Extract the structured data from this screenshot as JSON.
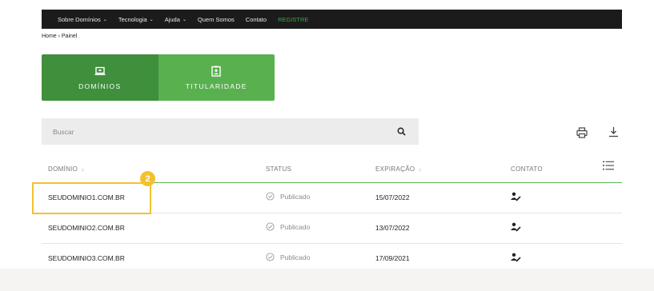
{
  "nav": {
    "items": [
      {
        "label": "Sobre Domínios",
        "dropdown": true
      },
      {
        "label": "Tecnologia",
        "dropdown": true
      },
      {
        "label": "Ajuda",
        "dropdown": true
      },
      {
        "label": "Quem Somos",
        "dropdown": false
      },
      {
        "label": "Contato",
        "dropdown": false
      },
      {
        "label": "REGISTRE",
        "dropdown": false
      }
    ],
    "dropdown_glyph": "⌄"
  },
  "breadcrumb": "Home › Painel",
  "tabs": [
    {
      "label": "DOMÍNIOS",
      "icon": "laptop-icon",
      "active": true
    },
    {
      "label": "TITULARIDADE",
      "icon": "id-badge-icon",
      "active": false
    }
  ],
  "search": {
    "placeholder": "Buscar",
    "value": ""
  },
  "table": {
    "headers": {
      "domain": "DOMÍNIO",
      "status": "STATUS",
      "expiration": "EXPIRAÇÃO",
      "contact": "CONTATO"
    },
    "sort_glyph": "↓",
    "rows": [
      {
        "domain": "SEUDOMINIO1.COM.BR",
        "status": "Publicado",
        "expiration": "15/07/2022"
      },
      {
        "domain": "SEUDOMINIO2.COM.BR",
        "status": "Publicado",
        "expiration": "13/07/2022"
      },
      {
        "domain": "SEUDOMINIO3.COM.BR",
        "status": "Publicado",
        "expiration": "17/09/2021"
      }
    ]
  },
  "annotation": {
    "step_number": "2"
  },
  "colors": {
    "nav_bg": "#1b1b1b",
    "tab_active": "#3f8f3c",
    "tab_inactive": "#59b04f",
    "accent_green": "#5bb554",
    "highlight": "#f2c12e"
  }
}
